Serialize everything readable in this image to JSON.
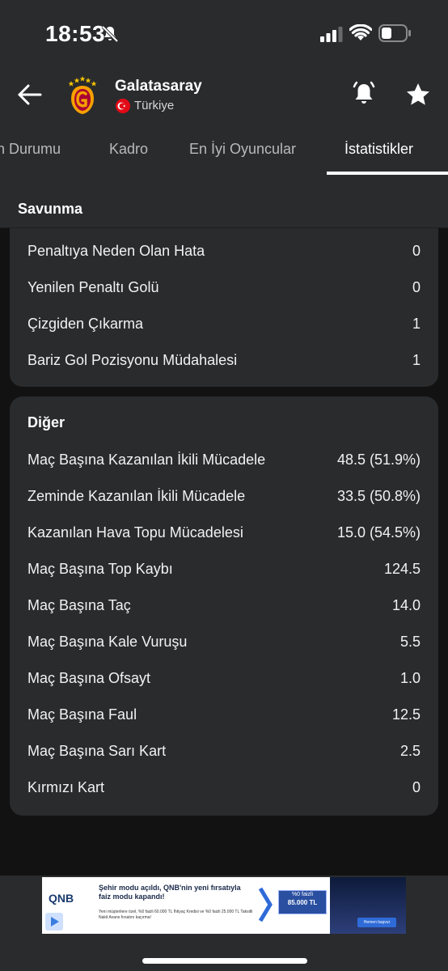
{
  "status": {
    "time": "18:53"
  },
  "header": {
    "team": "Galatasaray",
    "country": "Türkiye"
  },
  "tabs": [
    {
      "label": "n Durumu"
    },
    {
      "label": "Kadro"
    },
    {
      "label": "En İyi Oyuncular"
    },
    {
      "label": "İstatistikler"
    }
  ],
  "savunma": {
    "title": "Savunma",
    "rows": [
      {
        "label": "Penaltıya Neden Olan Hata",
        "value": "0"
      },
      {
        "label": "Yenilen Penaltı Golü",
        "value": "0"
      },
      {
        "label": "Çizgiden Çıkarma",
        "value": "1"
      },
      {
        "label": "Bariz Gol Pozisyonu Müdahalesi",
        "value": "1"
      }
    ]
  },
  "diger": {
    "title": "Diğer",
    "rows": [
      {
        "label": "Maç Başına Kazanılan İkili Mücadele",
        "value": "48.5 (51.9%)"
      },
      {
        "label": "Zeminde Kazanılan İkili Mücadele",
        "value": "33.5 (50.8%)"
      },
      {
        "label": "Kazanılan Hava Topu Mücadelesi",
        "value": "15.0 (54.5%)"
      },
      {
        "label": "Maç Başına Top Kaybı",
        "value": "124.5"
      },
      {
        "label": "Maç Başına Taç",
        "value": "14.0"
      },
      {
        "label": "Maç Başına Kale Vuruşu",
        "value": "5.5"
      },
      {
        "label": "Maç Başına Ofsayt",
        "value": "1.0"
      },
      {
        "label": "Maç Başına Faul",
        "value": "12.5"
      },
      {
        "label": "Maç Başına Sarı Kart",
        "value": "2.5"
      },
      {
        "label": "Kırmızı Kart",
        "value": "0"
      }
    ]
  },
  "ad": {
    "logo": "QNB",
    "headline": "Şehir modu açıldı, QNB'nin yeni fırsatıyla faiz modu kapandı!",
    "fine_print": "Yeni müşterilere özel, %0 faizli 60.000 TL İhtiyaç Kredisi ve %0 faizli 25.000 TL Taksitli Nakit Avans fırsatını kaçırma!",
    "rate_line1": "%0 faizli",
    "rate_line2": "85.000 TL",
    "cta": "Hemen başvur"
  },
  "colors": {
    "background": "#121212",
    "card": "#2a2b2d",
    "text": "#ffffff",
    "muted": "#b9b9b9",
    "flag": "#e30a17",
    "logo_orange": "#f5a000",
    "logo_red": "#a90432"
  },
  "icons": [
    "bell-off-icon",
    "signal-icon",
    "wifi-icon",
    "battery-icon",
    "back-arrow-icon",
    "bell-ring-icon",
    "star-icon"
  ]
}
